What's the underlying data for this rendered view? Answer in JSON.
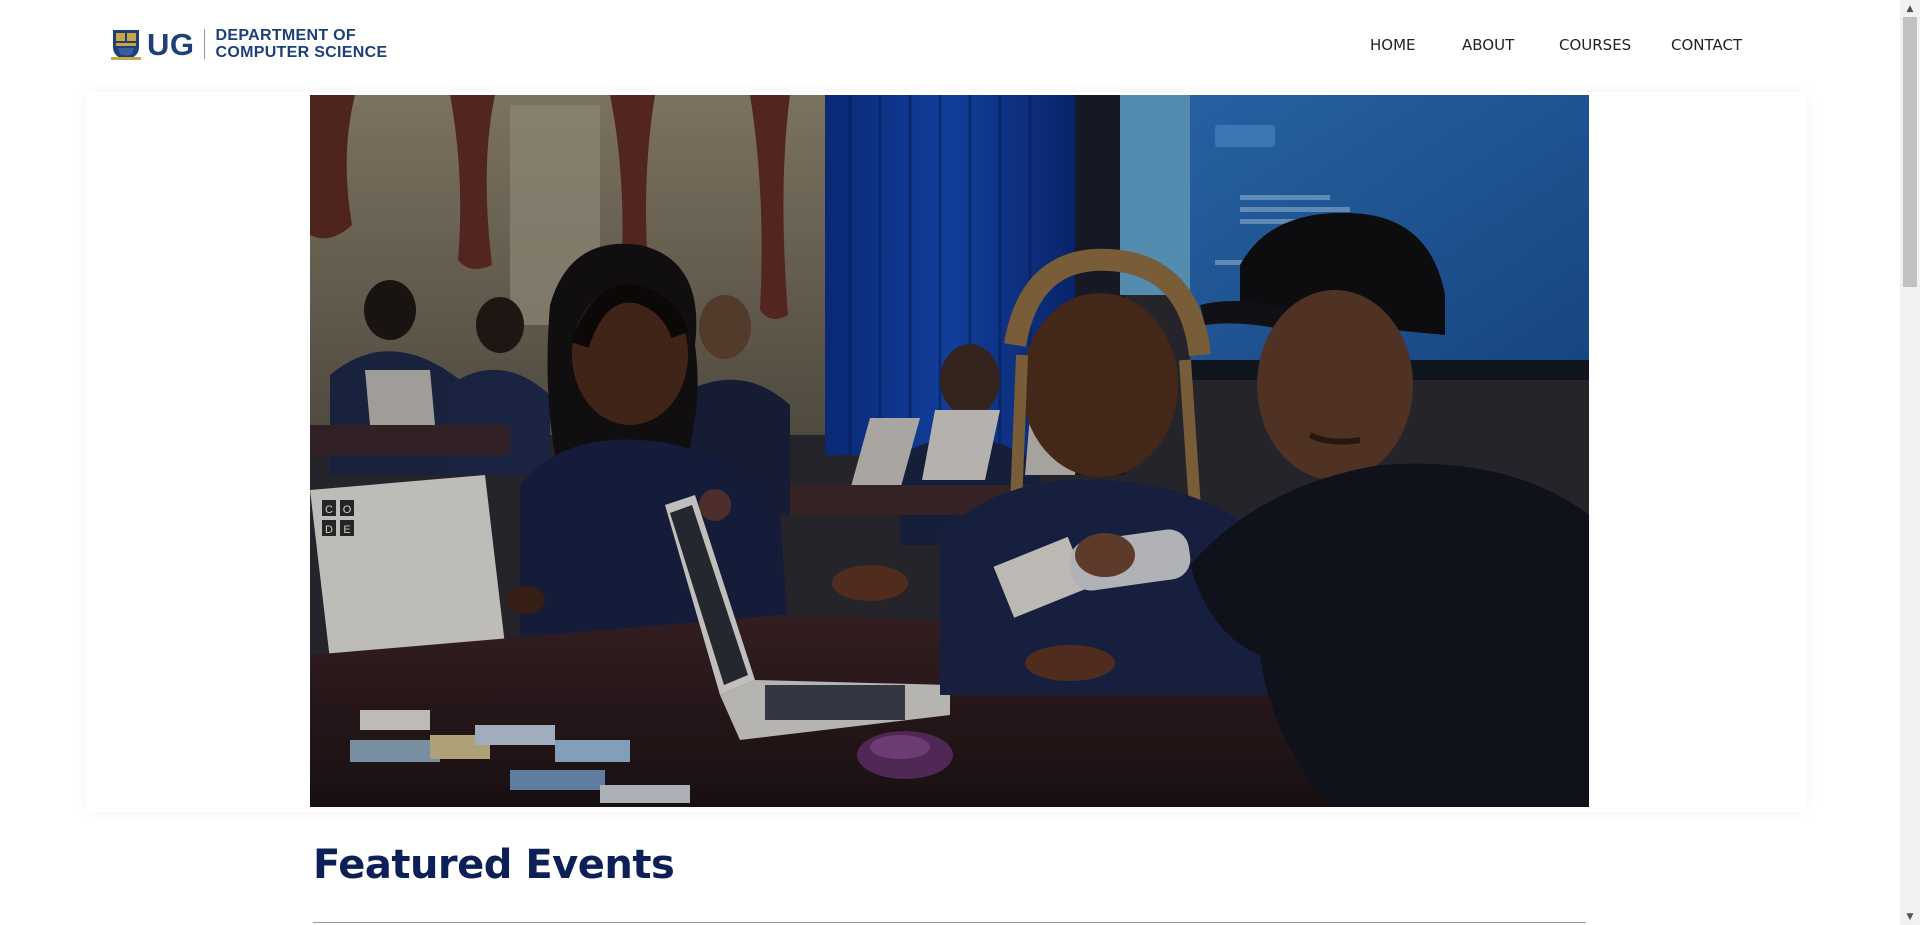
{
  "header": {
    "logo": {
      "short": "UG",
      "department_line1": "DEPARTMENT OF",
      "department_line2": "COMPUTER SCIENCE",
      "crest_icon": "university-crest-icon"
    },
    "nav": [
      {
        "label": "HOME"
      },
      {
        "label": "ABOUT"
      },
      {
        "label": "COURSES"
      },
      {
        "label": "CONTACT"
      }
    ]
  },
  "hero": {
    "image_icon": "hero-photo",
    "laptop_sticker": [
      "C",
      "O",
      "D",
      "E"
    ]
  },
  "featured": {
    "title": "Featured Events"
  },
  "colors": {
    "brand_navy": "#1f3f7a",
    "heading_navy": "#0c1f57",
    "nav_text": "#222222"
  }
}
